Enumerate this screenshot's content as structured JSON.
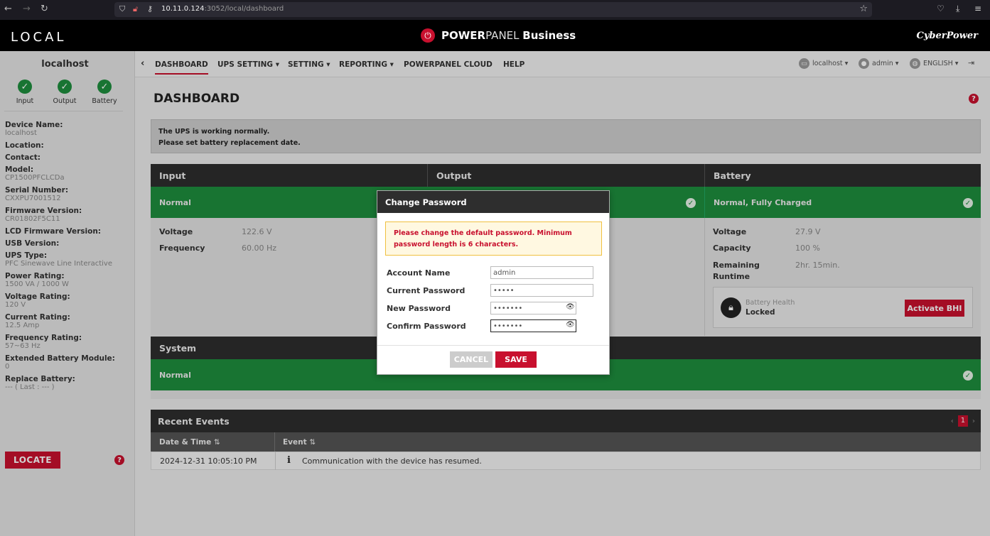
{
  "browser": {
    "back_icon": "←",
    "forward_icon": "→",
    "reload_icon": "↻",
    "url_host": "10.11.0.124",
    "url_rest": ":3052/local/dashboard"
  },
  "header": {
    "brand_left": "LOCAL",
    "brand_center_light": "POWER",
    "brand_center_panel": "PANEL",
    "brand_center_bold": "Business",
    "brand_right": "CyberPower"
  },
  "sidebar": {
    "host": "localhost",
    "statuses": [
      {
        "label": "Input",
        "icon": "check-icon"
      },
      {
        "label": "Output",
        "icon": "check-icon"
      },
      {
        "label": "Battery",
        "icon": "check-icon"
      }
    ],
    "info": [
      {
        "key": "Device Name:",
        "value": "localhost"
      },
      {
        "key": "Location:",
        "value": ""
      },
      {
        "key": "Contact:",
        "value": ""
      },
      {
        "key": "Model:",
        "value": "CP1500PFCLCDa"
      },
      {
        "key": "Serial Number:",
        "value": "CXXPU7001512"
      },
      {
        "key": "Firmware Version:",
        "value": "CR01802F5C11"
      },
      {
        "key": "LCD Firmware Version:",
        "value": ""
      },
      {
        "key": "USB Version:",
        "value": ""
      },
      {
        "key": "UPS Type:",
        "value": "PFC Sinewave Line Interactive"
      },
      {
        "key": "Power Rating:",
        "value": "1500 VA / 1000 W"
      },
      {
        "key": "Voltage Rating:",
        "value": "120 V"
      },
      {
        "key": "Current Rating:",
        "value": "12.5 Amp"
      },
      {
        "key": "Frequency Rating:",
        "value": "57~63 Hz"
      },
      {
        "key": "Extended Battery Module:",
        "value": "0"
      },
      {
        "key": "Replace Battery:",
        "value": "--- ( Last : --- )"
      }
    ],
    "locate_label": "LOCATE"
  },
  "nav": {
    "items": [
      "DASHBOARD",
      "UPS SETTING",
      "SETTING",
      "REPORTING",
      "POWERPANEL CLOUD",
      "HELP"
    ],
    "right": {
      "host": "localhost",
      "user": "admin",
      "language": "ENGLISH"
    }
  },
  "main": {
    "title": "DASHBOARD",
    "alert_line1": "The UPS is working normally.",
    "alert_line2": "Please set battery replacement date.",
    "input": {
      "title": "Input",
      "status": "Normal",
      "stats": [
        {
          "key": "Voltage",
          "value": "122.6 V"
        },
        {
          "key": "Frequency",
          "value": "60.00 Hz"
        }
      ]
    },
    "output": {
      "title": "Output"
    },
    "battery": {
      "title": "Battery",
      "status": "Normal, Fully Charged",
      "stats": [
        {
          "key": "Voltage",
          "value": "27.9 V"
        },
        {
          "key": "Capacity",
          "value": "100 %"
        },
        {
          "key": "Remaining Runtime",
          "value": "2hr. 15min."
        }
      ],
      "bhi_label": "Battery Health",
      "bhi_value": "Locked",
      "bhi_button": "Activate BHI"
    },
    "system": {
      "title": "System",
      "status": "Normal"
    }
  },
  "events": {
    "title": "Recent Events",
    "page": "1",
    "col_date": "Date & Time",
    "col_event": "Event",
    "sort_icon": "⇅",
    "rows": [
      {
        "datetime": "2024-12-31 10:05:10 PM",
        "icon": "i",
        "event": "Communication with the device has resumed."
      }
    ]
  },
  "modal": {
    "title": "Change Password",
    "warning_line1": "Please change the default password. Minimum",
    "warning_line2": "password length is 6 characters.",
    "fields": [
      {
        "label": "Account Name",
        "value": "admin"
      },
      {
        "label": "Current Password",
        "value": "•••••"
      },
      {
        "label": "New Password",
        "value": "•••••••"
      },
      {
        "label": "Confirm Password",
        "value": "•••••••"
      }
    ],
    "cancel": "CANCEL",
    "save": "SAVE"
  },
  "colors": {
    "accent": "#c8102e",
    "status_green": "#1e8e3e",
    "panel_dark": "#2e2e2e"
  }
}
